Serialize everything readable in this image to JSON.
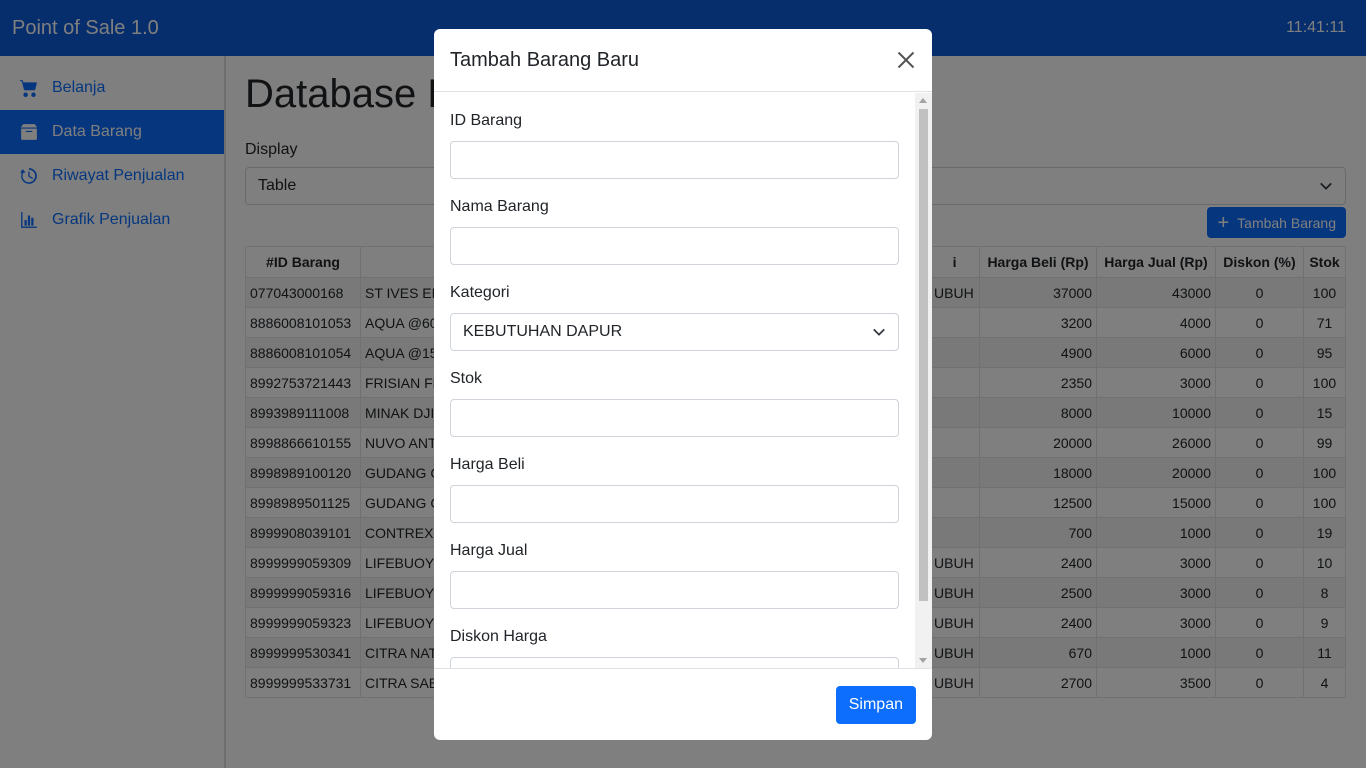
{
  "app": {
    "title": "Point of Sale 1.0",
    "clock": "11:41:11"
  },
  "colors": {
    "primary": "#0d6efd"
  },
  "sidebar": {
    "items": [
      {
        "label": "Belanja",
        "icon": "cart-icon"
      },
      {
        "label": "Data Barang",
        "icon": "archive-icon",
        "active": true
      },
      {
        "label": "Riwayat Penjualan",
        "icon": "history-icon"
      },
      {
        "label": "Grafik Penjualan",
        "icon": "chart-icon"
      }
    ]
  },
  "main": {
    "title": "Database B",
    "display_label": "Display",
    "display_value": "Table",
    "add_button": "Tambah Barang",
    "table": {
      "headers": [
        "#ID Barang",
        "",
        "i",
        "Harga Beli (Rp)",
        "Harga Jual (Rp)",
        "Diskon (%)",
        "Stok"
      ],
      "rows": [
        [
          "077043000168",
          "ST IVES ENI",
          "UBUH",
          "37000",
          "43000",
          "0",
          "100"
        ],
        [
          "8886008101053",
          "AQUA @60",
          "",
          "3200",
          "4000",
          "0",
          "71"
        ],
        [
          "8886008101054",
          "AQUA @15",
          "",
          "4900",
          "6000",
          "0",
          "95"
        ],
        [
          "8992753721443",
          "FRISIAN FL",
          "",
          "2350",
          "3000",
          "0",
          "100"
        ],
        [
          "8993989111008",
          "MINAK DJII",
          "",
          "8000",
          "10000",
          "0",
          "15"
        ],
        [
          "8998866610155",
          "NUVO ANT",
          "",
          "20000",
          "26000",
          "0",
          "99"
        ],
        [
          "8998989100120",
          "GUDANG G",
          "",
          "18000",
          "20000",
          "0",
          "100"
        ],
        [
          "8998989501125",
          "GUDANG G",
          "",
          "12500",
          "15000",
          "0",
          "100"
        ],
        [
          "8999908039101",
          "CONTREXY",
          "",
          "700",
          "1000",
          "0",
          "19"
        ],
        [
          "8999999059309",
          "LIFEBUOY (",
          "UBUH",
          "2400",
          "3000",
          "0",
          "10"
        ],
        [
          "8999999059316",
          "LIFEBUOY (",
          "UBUH",
          "2500",
          "3000",
          "0",
          "8"
        ],
        [
          "8999999059323",
          "LIFEBUOY (",
          "UBUH",
          "2400",
          "3000",
          "0",
          "9"
        ],
        [
          "8999999530341",
          "CITRA NAT",
          "UBUH",
          "670",
          "1000",
          "0",
          "11"
        ],
        [
          "8999999533731",
          "CITRA SABU",
          "UBUH",
          "2700",
          "3500",
          "0",
          "4"
        ]
      ]
    }
  },
  "modal": {
    "title": "Tambah Barang Baru",
    "fields": [
      {
        "label": "ID Barang",
        "value": ""
      },
      {
        "label": "Nama Barang",
        "value": ""
      },
      {
        "label": "Kategori",
        "value": "KEBUTUHAN DAPUR",
        "type": "select"
      },
      {
        "label": "Stok",
        "value": ""
      },
      {
        "label": "Harga Beli",
        "value": ""
      },
      {
        "label": "Harga Jual",
        "value": ""
      },
      {
        "label": "Diskon Harga",
        "value": ""
      }
    ],
    "save_button": "Simpan"
  }
}
